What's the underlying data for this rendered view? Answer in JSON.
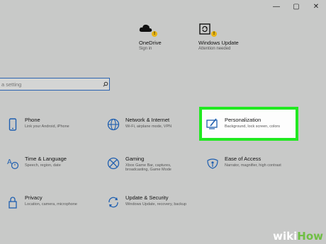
{
  "window_controls": {
    "minimize": "—",
    "maximize": "▢",
    "close": "✕"
  },
  "status_items": [
    {
      "name": "OneDrive",
      "sub": "Sign in",
      "badge": "!",
      "icon": "cloud-icon"
    },
    {
      "name": "Windows Update",
      "sub": "Attention needed",
      "badge": "!",
      "icon": "update-icon"
    }
  ],
  "search": {
    "placeholder": "a setting"
  },
  "tiles": [
    {
      "title": "Phone",
      "desc": "Link your Android, iPhone",
      "icon": "phone-icon"
    },
    {
      "title": "Network & Internet",
      "desc": "Wi-Fi, airplane mode, VPN",
      "icon": "globe-icon"
    },
    {
      "title": "Personalization",
      "desc": "Background, lock screen, colors",
      "icon": "paint-icon"
    },
    {
      "title": "Time & Language",
      "desc": "Speech, region, date",
      "icon": "time-language-icon"
    },
    {
      "title": "Gaming",
      "desc": "Xbox Game Bar, captures, broadcasting, Game Mode",
      "icon": "xbox-icon"
    },
    {
      "title": "Ease of Access",
      "desc": "Narrator, magnifier, high contrast",
      "icon": "ease-of-access-icon"
    },
    {
      "title": "Privacy",
      "desc": "Location, camera, microphone",
      "icon": "lock-icon"
    },
    {
      "title": "Update & Security",
      "desc": "Windows Update, recovery, backup",
      "icon": "sync-icon"
    }
  ],
  "watermark": {
    "part1": "wiki",
    "part2": "How"
  },
  "colors": {
    "accent": "#1f5fb0",
    "highlight": "#21e921",
    "badge": "#e7b416",
    "background": "#c8c9c8"
  }
}
